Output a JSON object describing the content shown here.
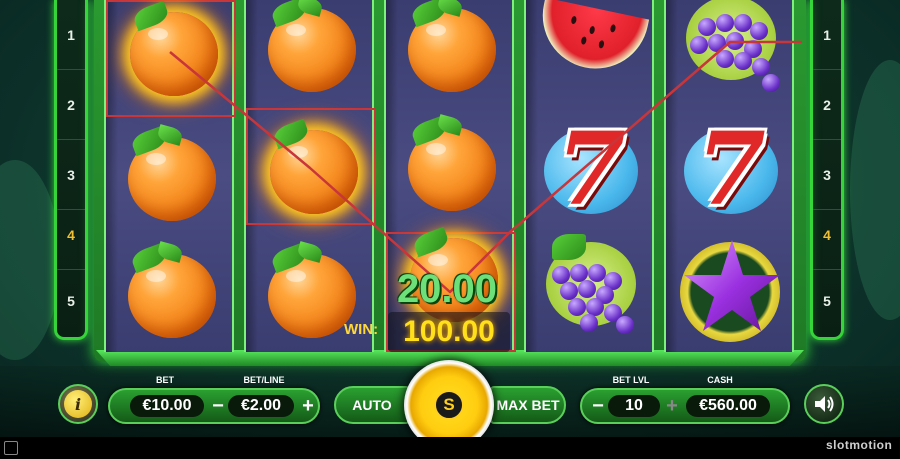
{
  "paylines": {
    "left": [
      "1",
      "2",
      "3",
      "4",
      "5"
    ],
    "right": [
      "1",
      "2",
      "3",
      "4",
      "5"
    ],
    "highlighted": "4"
  },
  "reels": [
    [
      "orange",
      "orange",
      "orange"
    ],
    [
      "orange",
      "orange",
      "orange"
    ],
    [
      "orange",
      "orange",
      "orange"
    ],
    [
      "watermelon",
      "seven",
      "grapes"
    ],
    [
      "grapes",
      "seven",
      "star"
    ]
  ],
  "win": {
    "line_amount": "20.00",
    "label": "WIN:",
    "total": "100.00"
  },
  "controls": {
    "bet_label": "BET",
    "bet_value": "€10.00",
    "bet_line_label": "BET/LINE",
    "bet_line_value": "€2.00",
    "minus": "−",
    "plus": "+",
    "auto_label": "AUTO",
    "spin_symbol": "S",
    "max_bet_label": "MAX BET",
    "bet_lvl_label": "BET LVL",
    "bet_lvl_value": "10",
    "cash_label": "CASH",
    "cash_value": "€560.00",
    "info_symbol": "i"
  },
  "brand": "slotmotion",
  "colors": {
    "frame_green": "#36d43a",
    "win_line": "#c8363a",
    "win_yellow": "#ffe01a",
    "line_win_green": "#6ee07a"
  },
  "icons": {
    "info": "info-icon",
    "sound": "speaker-icon",
    "spin": "spin-icon"
  }
}
